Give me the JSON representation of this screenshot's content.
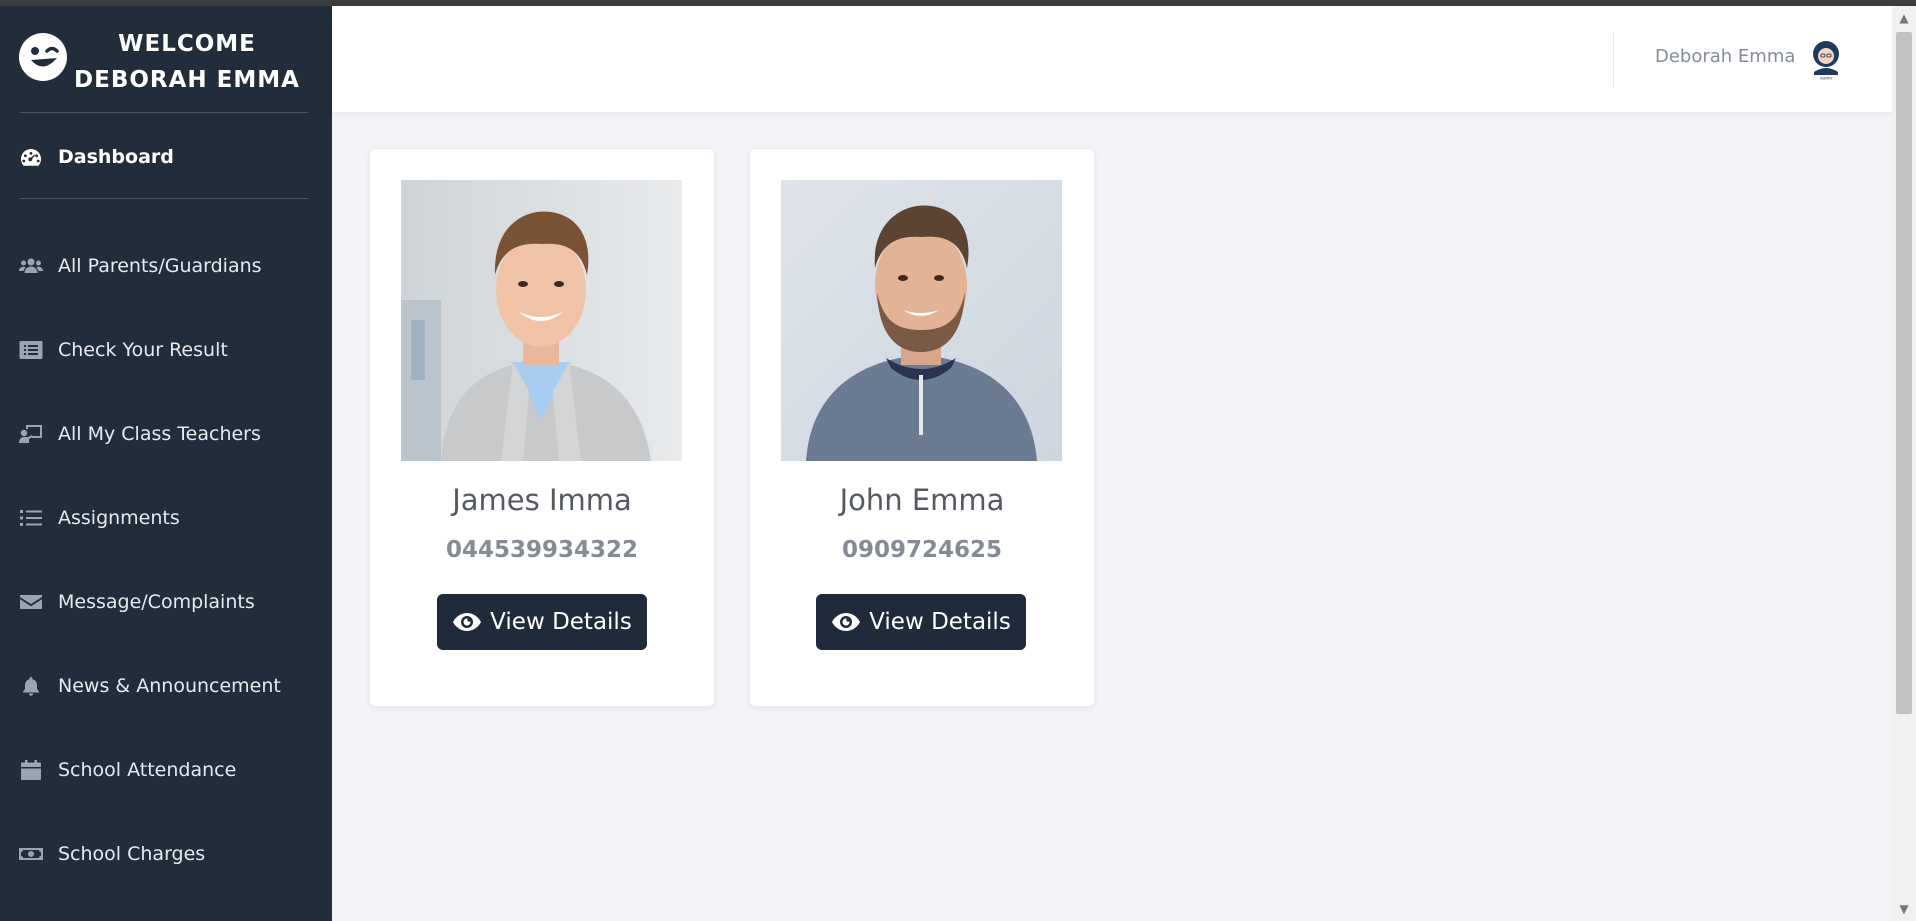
{
  "sidebar": {
    "brand": {
      "line1": "WELCOME",
      "line2": "DEBORAH EMMA",
      "icon": "winking-face-icon"
    },
    "items": [
      {
        "label": "Dashboard",
        "icon": "tachometer-icon",
        "active": true
      },
      {
        "label": "All Parents/Guardians",
        "icon": "users-icon"
      },
      {
        "label": "Check Your Result",
        "icon": "list-alt-icon"
      },
      {
        "label": "All My Class Teachers",
        "icon": "chalkboard-teacher-icon"
      },
      {
        "label": "Assignments",
        "icon": "list-icon"
      },
      {
        "label": "Message/Complaints",
        "icon": "envelope-icon"
      },
      {
        "label": "News & Announcement",
        "icon": "bell-icon"
      },
      {
        "label": "School Attendance",
        "icon": "calendar-icon"
      },
      {
        "label": "School Charges",
        "icon": "money-bill-icon"
      }
    ]
  },
  "header": {
    "user_name": "Deborah Emma",
    "avatar_icon": "admin-avatar-icon"
  },
  "cards": [
    {
      "name": "James Imma",
      "phone": "044539934322",
      "button_label": "View Details",
      "button_icon": "eye-icon"
    },
    {
      "name": "John Emma",
      "phone": "0909724625",
      "button_label": "View Details",
      "button_icon": "eye-icon"
    }
  ],
  "colors": {
    "sidebar_bg": "#222d3b",
    "button_bg": "#1f2b3b",
    "page_bg": "#f3f4f8"
  }
}
